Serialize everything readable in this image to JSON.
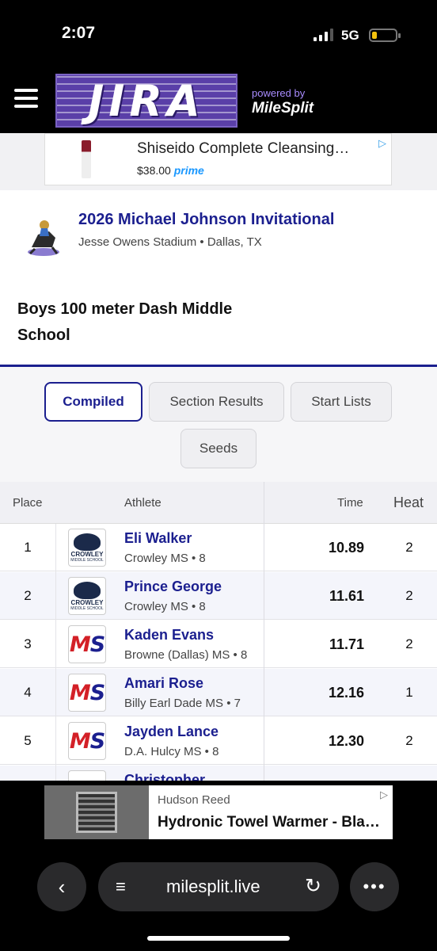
{
  "status_bar": {
    "time": "2:07",
    "network": "5G"
  },
  "header": {
    "logo_text": "JIRA",
    "powered_by": "powered by",
    "brand": "MileSplit"
  },
  "top_ad": {
    "title": "Shiseido Complete Cleansing…",
    "price": "$38.00",
    "prime": "prime",
    "ad_icon": "▷"
  },
  "meet": {
    "name": "2026 Michael Johnson Invitational",
    "venue": "Jesse Owens Stadium • Dallas, TX",
    "event": "Boys 100 meter Dash Middle School"
  },
  "tabs": [
    {
      "label": "Compiled",
      "active": true
    },
    {
      "label": "Section Results",
      "active": false
    },
    {
      "label": "Start Lists",
      "active": false
    },
    {
      "label": "Seeds",
      "active": false
    }
  ],
  "table": {
    "headers": {
      "place": "Place",
      "athlete": "Athlete",
      "time": "Time",
      "heat": "Heat"
    },
    "rows": [
      {
        "place": "1",
        "name": "Eli Walker",
        "team": "Crowley MS • 8",
        "time": "10.89",
        "heat": "2",
        "logo": "crowley"
      },
      {
        "place": "2",
        "name": "Prince George",
        "team": "Crowley MS • 8",
        "time": "11.61",
        "heat": "2",
        "logo": "crowley"
      },
      {
        "place": "3",
        "name": "Kaden Evans",
        "team": "Browne (Dallas) MS • 8",
        "time": "11.71",
        "heat": "2",
        "logo": "ms"
      },
      {
        "place": "4",
        "name": "Amari Rose",
        "team": "Billy Earl Dade MS • 7",
        "time": "12.16",
        "heat": "1",
        "logo": "ms"
      },
      {
        "place": "5",
        "name": "Jayden Lance",
        "team": "D.A. Hulcy MS • 8",
        "time": "12.30",
        "heat": "2",
        "logo": "ms"
      },
      {
        "place": "",
        "name": "Christopher",
        "team": "",
        "time": "",
        "heat": "",
        "logo": "ms"
      }
    ]
  },
  "logo_text": {
    "crowley_line1": "CROWLEY",
    "crowley_line2": "MIDDLE SCHOOL",
    "ms_m": "M",
    "ms_s": "S"
  },
  "bottom_ad": {
    "brand": "Hudson Reed",
    "title": "Hydronic Towel Warmer - Bla…",
    "ad_icon": "▷"
  },
  "browser": {
    "url": "milesplit.live"
  }
}
